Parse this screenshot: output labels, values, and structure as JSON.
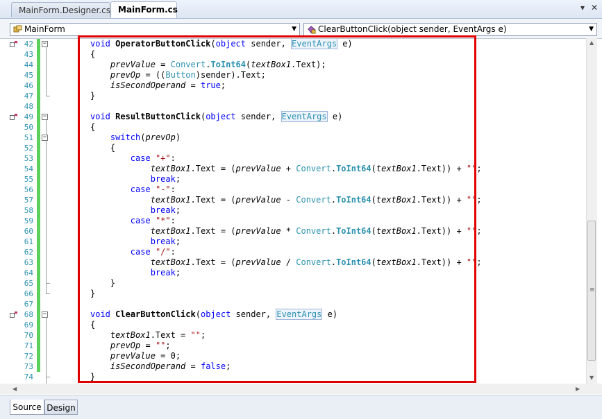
{
  "tabs": [
    {
      "label": "MainForm.Designer.cs",
      "active": false
    },
    {
      "label": "MainForm.cs",
      "active": true
    }
  ],
  "tab_controls": {
    "dropdown_glyph": "▾",
    "close_glyph": "✕"
  },
  "navigation": {
    "type_combo": {
      "value": "MainForm",
      "icon": "class-icon"
    },
    "member_combo": {
      "value": "ClearButtonClick(object sender, EventArgs e)",
      "icon": "method-icon"
    }
  },
  "editor": {
    "lines": [
      {
        "num": "42",
        "text": "void OperatorButtonClick(object sender, EventArgs e)"
      },
      {
        "num": "43",
        "text": "{"
      },
      {
        "num": "44",
        "text": "    prevValue = Convert.ToInt64(textBox1.Text);"
      },
      {
        "num": "45",
        "text": "    prevOp = ((Button)sender).Text;"
      },
      {
        "num": "46",
        "text": "    isSecondOperand = true;"
      },
      {
        "num": "47",
        "text": "}"
      },
      {
        "num": "48",
        "text": ""
      },
      {
        "num": "49",
        "text": "void ResultButtonClick(object sender, EventArgs e)"
      },
      {
        "num": "50",
        "text": "{"
      },
      {
        "num": "51",
        "text": "    switch(prevOp)"
      },
      {
        "num": "52",
        "text": "    {"
      },
      {
        "num": "53",
        "text": "        case \"+\":"
      },
      {
        "num": "54",
        "text": "            textBox1.Text = (prevValue + Convert.ToInt64(textBox1.Text)) + \"\";"
      },
      {
        "num": "55",
        "text": "            break;"
      },
      {
        "num": "56",
        "text": "        case \"-\":"
      },
      {
        "num": "57",
        "text": "            textBox1.Text = (prevValue - Convert.ToInt64(textBox1.Text)) + \"\";"
      },
      {
        "num": "58",
        "text": "            break;"
      },
      {
        "num": "59",
        "text": "        case \"*\":"
      },
      {
        "num": "60",
        "text": "            textBox1.Text = (prevValue * Convert.ToInt64(textBox1.Text)) + \"\";"
      },
      {
        "num": "61",
        "text": "            break;"
      },
      {
        "num": "62",
        "text": "        case \"/\":"
      },
      {
        "num": "63",
        "text": "            textBox1.Text = (prevValue / Convert.ToInt64(textBox1.Text)) + \"\";"
      },
      {
        "num": "64",
        "text": "            break;"
      },
      {
        "num": "65",
        "text": "    }"
      },
      {
        "num": "66",
        "text": "}"
      },
      {
        "num": "67",
        "text": ""
      },
      {
        "num": "68",
        "text": "void ClearButtonClick(object sender, EventArgs e)"
      },
      {
        "num": "69",
        "text": "{"
      },
      {
        "num": "70",
        "text": "    textBox1.Text = \"\";"
      },
      {
        "num": "71",
        "text": "    prevOp = \"\";"
      },
      {
        "num": "72",
        "text": "    prevValue = 0;"
      },
      {
        "num": "73",
        "text": "    isSecondOperand = false;"
      },
      {
        "num": "74",
        "text": "}"
      }
    ],
    "keywords": [
      "void",
      "object",
      "switch",
      "case",
      "break",
      "true",
      "false"
    ],
    "types": [
      "Convert",
      "Button",
      "EventArgs"
    ],
    "colors": {
      "keyword": "#0000ff",
      "type": "#2b91af",
      "string": "#a31515",
      "line_number": "#2b91af",
      "change_bar": "#5bd15b",
      "highlight_box": "#e00000"
    }
  },
  "bottom_tabs": [
    {
      "label": "Source",
      "active": true
    },
    {
      "label": "Design",
      "active": false
    }
  ]
}
